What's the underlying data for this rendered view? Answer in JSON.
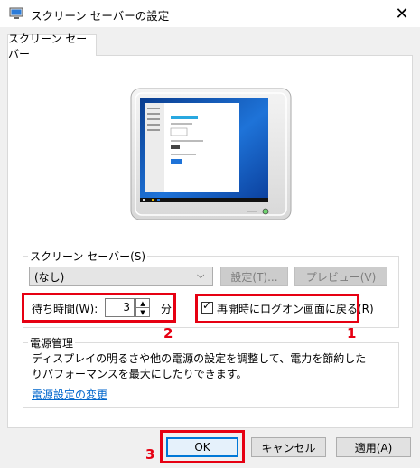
{
  "window": {
    "title": "スクリーン セーバーの設定",
    "close_glyph": "✕"
  },
  "tab": {
    "label": "スクリーン セーバー"
  },
  "screensaver": {
    "group_label": "スクリーン セーバー(S)",
    "selected": "(なし)",
    "settings_label": "設定(T)...",
    "preview_label": "プレビュー(V)",
    "wait_label": "待ち時間(W):",
    "wait_value": "3",
    "minutes_label": "分",
    "logon_label": "再開時にログオン画面に戻る(R)",
    "logon_checked": true
  },
  "power": {
    "group_label": "電源管理",
    "description": "ディスプレイの明るさや他の電源の設定を調整して、電力を節約したりパフォーマンスを最大にしたりできます。",
    "link": "電源設定の変更"
  },
  "buttons": {
    "ok": "OK",
    "cancel": "キャンセル",
    "apply": "適用(A)"
  },
  "annotations": {
    "num1": "1",
    "num2": "2",
    "num3": "3",
    "color": "#e60012"
  },
  "icons": {
    "app": "screensaver-app-icon",
    "close": "close-icon",
    "dropdown": "chevron-down-icon",
    "spin_up": "spin-up-icon",
    "spin_down": "spin-down-icon",
    "check": "checkmark-icon"
  }
}
